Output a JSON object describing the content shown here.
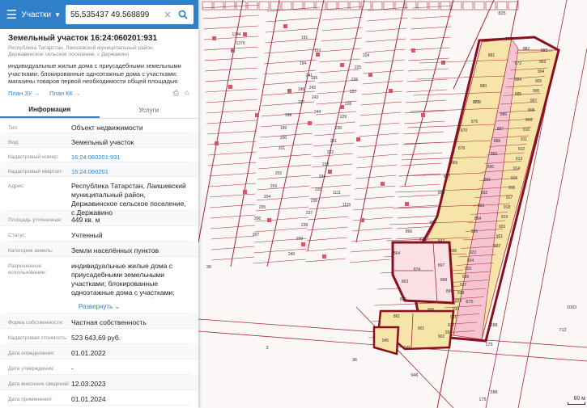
{
  "search": {
    "category": "Участки",
    "query": "55.535437 49.568899"
  },
  "card": {
    "title": "Земельный участок 16:24:060201:931",
    "subtitle": "Республика Татарстан, Лаишевский муниципальный район, Державинское сельское поселение, с Державино",
    "description": "индивидуальные жилые дома с приусадебными земельными участками; блокированные одноэтажные дома с участками; магазины товаров первой необходимости общей площадью не...",
    "link_zu": "План ЗУ →",
    "link_kk": "План КК →"
  },
  "tabs": [
    "Информация",
    "Услуги"
  ],
  "info": {
    "type_label": "Тип:",
    "type_value": "Объект недвижимости",
    "kind_label": "Вид:",
    "kind_value": "Земельный участок",
    "cad_label": "Кадастровый номер:",
    "cad_value": "16:24:060201:931",
    "quarter_label": "Кадастровый квартал:",
    "quarter_value": "16:24:060201",
    "address_label": "Адрес:",
    "address_value": "Республика Татарстан, Лаишевский муниципальный район, Державинское сельское поселение, с Державино",
    "area_label": "Площадь уточненная:",
    "area_value": "449 кв. м",
    "status_label": "Статус:",
    "status_value": "Учтенный",
    "category_label": "Категория земель:",
    "category_value": "Земли населённых пунктов",
    "use_label": "Разрешенное использование:",
    "use_value": "индивидуальные жилые дома с приусадебными земельными участками; блокированные одноэтажные дома с участками; магазины товаров первой",
    "expand": "Развернуть ⌄",
    "ownership_label": "Форма собственности:",
    "ownership_value": "Частная собственность",
    "cost_label": "Кадастровая стоимость:",
    "cost_value": "523 643,69 руб.",
    "def_date_label": "Дата определения:",
    "def_date_value": "01.01.2022",
    "appr_date_label": "Дата утверждения:",
    "appr_date_value": "-",
    "entry_date_label": "Дата внесения сведений:",
    "entry_date_value": "12.03.2023",
    "apply_date_label": "Дата применения:",
    "apply_date_value": "01.01.2024"
  },
  "map": {
    "scale_label": "60 м",
    "parcel_labels_right": [
      "881",
      "879",
      "880",
      "876",
      "871",
      "870",
      "878",
      "869",
      "877",
      "868",
      "867",
      "875",
      "873",
      "883",
      "882",
      "872",
      "874",
      "884",
      "885",
      "886",
      "887",
      "888",
      "889",
      "890",
      "891",
      "892",
      "893",
      "894",
      "895",
      "896",
      "897",
      "898",
      "899",
      "900",
      "901",
      "902",
      "903",
      "904",
      "905",
      "906",
      "907",
      "908",
      "909",
      "910",
      "911",
      "912",
      "913",
      "914",
      "915",
      "916",
      "917",
      "918",
      "919",
      "920",
      "921",
      "922",
      "923",
      "924",
      "925",
      "926",
      "927",
      "928",
      "929",
      "930",
      "931",
      "932",
      "933",
      "866",
      "864",
      "863",
      "865",
      "861",
      "945",
      "946",
      "947"
    ],
    "parcel_labels_left": [
      "191",
      "193",
      "194",
      "195",
      "196",
      "197",
      "198",
      "199",
      "200",
      "201",
      "202",
      "203",
      "204",
      "205",
      "206",
      "207",
      "224",
      "225",
      "226",
      "227",
      "228",
      "229",
      "230",
      "231",
      "232",
      "233",
      "234",
      "235",
      "236",
      "237",
      "238",
      "239",
      "240",
      "241",
      "242",
      "243",
      "244",
      "1344",
      "1379",
      "1111",
      "1115"
    ],
    "misc_labels": [
      "36",
      "288",
      "175",
      "712",
      "1003",
      "875",
      "3",
      "36",
      "946",
      "175",
      "288",
      "825"
    ]
  },
  "colors": {
    "accent": "#2f80c9",
    "parcel_line": "#a52a3a",
    "highlight": "#c2185b",
    "parcel_fill": "#f7e4a8",
    "pink_fill": "#f5c4d0"
  }
}
